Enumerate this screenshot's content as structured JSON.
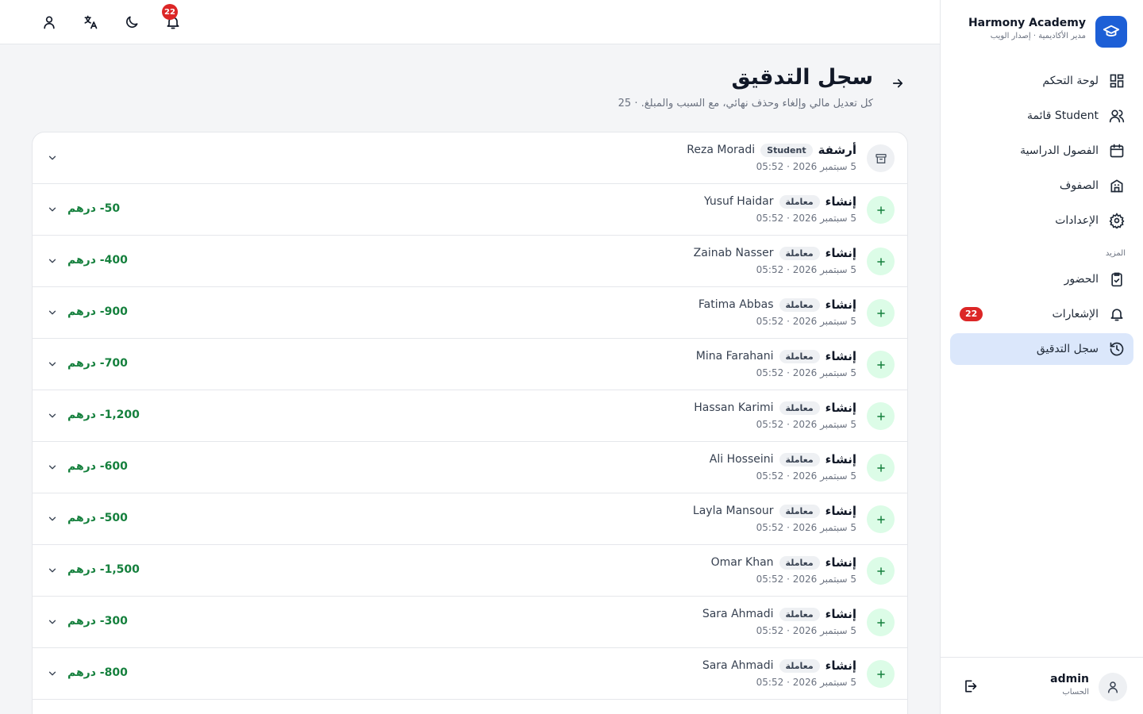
{
  "brand": {
    "name": "Harmony Academy",
    "subtitle": "مدير الأكاديمية · إصدار الويب"
  },
  "nav": {
    "items": [
      {
        "label": "لوحة التحكم",
        "icon": "dashboard-icon"
      },
      {
        "label": "قائمة Student",
        "icon": "users-icon"
      },
      {
        "label": "الفصول الدراسية",
        "icon": "calendar-icon"
      },
      {
        "label": "الصفوف",
        "icon": "building-icon"
      },
      {
        "label": "الإعدادات",
        "icon": "gear-icon"
      }
    ],
    "section_more": "المزيد",
    "more_items": [
      {
        "label": "الحضور",
        "icon": "clipboard-icon"
      },
      {
        "label": "الإشعارات",
        "icon": "bell-icon",
        "badge": "22"
      },
      {
        "label": "سجل التدقيق",
        "icon": "history-icon",
        "active": true
      }
    ]
  },
  "account": {
    "name": "admin",
    "role": "الحساب"
  },
  "topbar": {
    "notifications_count": "22"
  },
  "page": {
    "title": "سجل التدقيق",
    "subtitle": "كل تعديل مالي وإلغاء وحذف نهائي، مع السبب والمبلغ. · 25"
  },
  "colors": {
    "accent": "#1d5fd6",
    "active_bg": "#dbe7fb",
    "badge": "#dc2626",
    "amount": "#15803d",
    "create_bg": "#dcfce7"
  },
  "log": [
    {
      "action": "أرشفة",
      "tag": "Student",
      "name": "Reza Moradi",
      "date": "5 سبتمبر 2026 · 05:52",
      "amount": "",
      "kind": "archive"
    },
    {
      "action": "إنشاء",
      "tag": "معاملة",
      "name": "Yusuf Haidar",
      "date": "5 سبتمبر 2026 · 05:52",
      "amount": "50- درهم",
      "kind": "create"
    },
    {
      "action": "إنشاء",
      "tag": "معاملة",
      "name": "Zainab Nasser",
      "date": "5 سبتمبر 2026 · 05:52",
      "amount": "400- درهم",
      "kind": "create"
    },
    {
      "action": "إنشاء",
      "tag": "معاملة",
      "name": "Fatima Abbas",
      "date": "5 سبتمبر 2026 · 05:52",
      "amount": "900- درهم",
      "kind": "create"
    },
    {
      "action": "إنشاء",
      "tag": "معاملة",
      "name": "Mina Farahani",
      "date": "5 سبتمبر 2026 · 05:52",
      "amount": "700- درهم",
      "kind": "create"
    },
    {
      "action": "إنشاء",
      "tag": "معاملة",
      "name": "Hassan Karimi",
      "date": "5 سبتمبر 2026 · 05:52",
      "amount": "1,200- درهم",
      "kind": "create"
    },
    {
      "action": "إنشاء",
      "tag": "معاملة",
      "name": "Ali Hosseini",
      "date": "5 سبتمبر 2026 · 05:52",
      "amount": "600- درهم",
      "kind": "create"
    },
    {
      "action": "إنشاء",
      "tag": "معاملة",
      "name": "Layla Mansour",
      "date": "5 سبتمبر 2026 · 05:52",
      "amount": "500- درهم",
      "kind": "create"
    },
    {
      "action": "إنشاء",
      "tag": "معاملة",
      "name": "Omar Khan",
      "date": "5 سبتمبر 2026 · 05:52",
      "amount": "1,500- درهم",
      "kind": "create"
    },
    {
      "action": "إنشاء",
      "tag": "معاملة",
      "name": "Sara Ahmadi",
      "date": "5 سبتمبر 2026 · 05:52",
      "amount": "300- درهم",
      "kind": "create"
    },
    {
      "action": "إنشاء",
      "tag": "معاملة",
      "name": "Sara Ahmadi",
      "date": "5 سبتمبر 2026 · 05:52",
      "amount": "800- درهم",
      "kind": "create"
    }
  ]
}
